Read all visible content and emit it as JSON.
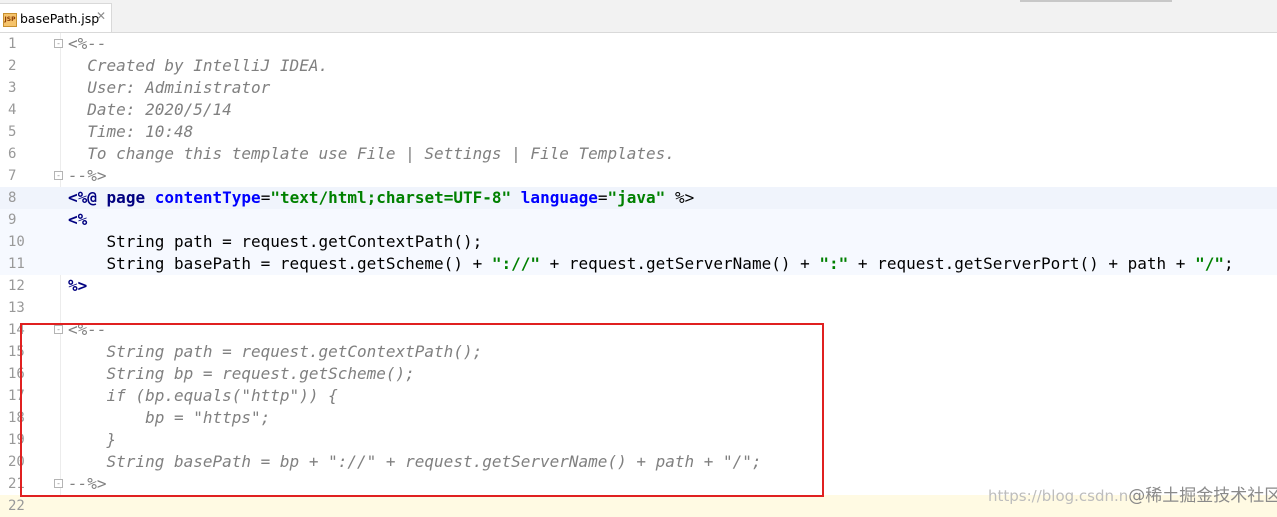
{
  "tab": {
    "filename": "basePath.jsp",
    "icon": "jsp-file-icon",
    "icon_text": "JSP"
  },
  "lines": [
    {
      "no": "1",
      "text": "<%--"
    },
    {
      "no": "2",
      "text": "  Created by IntelliJ IDEA."
    },
    {
      "no": "3",
      "text": "  User: Administrator"
    },
    {
      "no": "4",
      "text": "  Date: 2020/5/14"
    },
    {
      "no": "5",
      "text": "  Time: 10:48"
    },
    {
      "no": "6",
      "text": "  To change this template use File | Settings | File Templates."
    },
    {
      "no": "7",
      "text": "--%>"
    },
    {
      "no": "8",
      "text": "<%@ page contentType=\"text/html;charset=UTF-8\" language=\"java\" %>"
    },
    {
      "no": "9",
      "text": "<%"
    },
    {
      "no": "10",
      "text": "    String path = request.getContextPath();"
    },
    {
      "no": "11",
      "text": "    String basePath = request.getScheme() + \"://\" + request.getServerName() + \":\" + request.getServerPort() + path + \"/\";"
    },
    {
      "no": "12",
      "text": "%>"
    },
    {
      "no": "13",
      "text": ""
    },
    {
      "no": "14",
      "text": "<%--"
    },
    {
      "no": "15",
      "text": "    String path = request.getContextPath();"
    },
    {
      "no": "16",
      "text": "    String bp = request.getScheme();"
    },
    {
      "no": "17",
      "text": "    if (bp.equals(\"http\")) {"
    },
    {
      "no": "18",
      "text": "        bp = \"https\";"
    },
    {
      "no": "19",
      "text": "    }"
    },
    {
      "no": "20",
      "text": "    String basePath = bp + \"://\" + request.getServerName() + path + \"/\";"
    },
    {
      "no": "21",
      "text": "--%>"
    },
    {
      "no": "22",
      "text": ""
    }
  ],
  "tokens": {
    "l8": {
      "open": "<%@",
      "page": "page",
      "attr1": "contentType",
      "eq1": "=",
      "val1": "\"text/html;charset=UTF-8\"",
      "attr2": "language",
      "eq2": "=",
      "val2": "\"java\"",
      "close": "%>"
    },
    "l9": {
      "open": "<%"
    },
    "l10": {
      "a": "    String path = request.getContextPath();"
    },
    "l11": {
      "a": "    String basePath = request.getScheme() + ",
      "s1": "\"://\"",
      "b": " + request.getServerName() + ",
      "s2": "\":\"",
      "c": " + request.getServerPort() + path + ",
      "s3": "\"/\"",
      "d": ";"
    },
    "l12": {
      "close": "%>"
    }
  },
  "watermark": {
    "url": "https://blog.csdn.n",
    "author": "@稀土掘金技术社区"
  },
  "colors": {
    "comment": "#808080",
    "keyword": "#000080",
    "attribute": "#0000ff",
    "string": "#008000",
    "highlight_box": "#e02020"
  }
}
